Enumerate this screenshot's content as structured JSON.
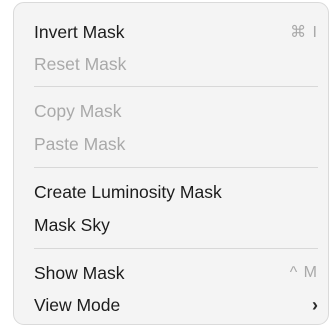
{
  "menu": {
    "items": [
      {
        "label": "Invert Mask",
        "shortcut": "⌘ I",
        "enabled": true
      },
      {
        "label": "Reset Mask",
        "enabled": false
      },
      {
        "label": "Copy Mask",
        "enabled": false
      },
      {
        "label": "Paste Mask",
        "enabled": false
      },
      {
        "label": "Create Luminosity Mask",
        "enabled": true
      },
      {
        "label": "Mask Sky",
        "enabled": true
      },
      {
        "label": "Show Mask",
        "shortcut": "^ M",
        "enabled": true
      },
      {
        "label": "View Mode",
        "submenu_icon": "chevron-right-icon",
        "enabled": true
      }
    ],
    "submenu_glyph": "›"
  }
}
